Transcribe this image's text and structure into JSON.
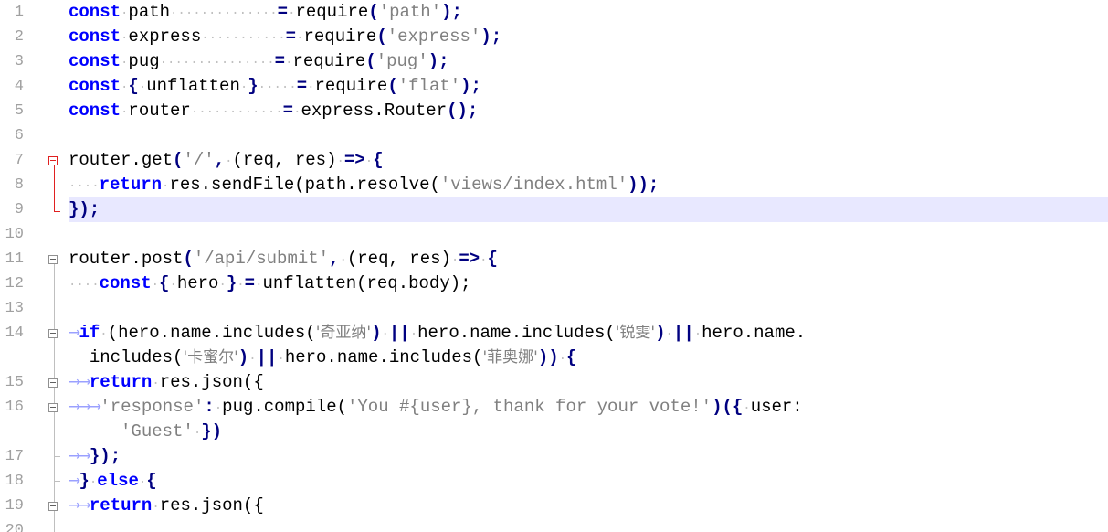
{
  "colors": {
    "keyword": "#0000ff",
    "string": "#808080",
    "operator": "#000080",
    "current_line_bg": "#e8e8ff",
    "fold_marker_active": "#e02020",
    "whitespace_marker": "#c0c0c0"
  },
  "gutter": {
    "line_numbers": [
      "1",
      "2",
      "3",
      "4",
      "5",
      "6",
      "7",
      "8",
      "9",
      "10",
      "11",
      "12",
      "13",
      "14",
      "15",
      "16",
      "17",
      "18",
      "19",
      "20"
    ]
  },
  "code": {
    "line1": {
      "kw": "const",
      "id": "path",
      "op": "=",
      "fn": "require",
      "str": "'path'"
    },
    "line2": {
      "kw": "const",
      "id": "express",
      "op": "=",
      "fn": "require",
      "str": "'express'"
    },
    "line3": {
      "kw": "const",
      "id": "pug",
      "op": "=",
      "fn": "require",
      "str": "'pug'"
    },
    "line4": {
      "kw": "const",
      "id": "unflatten",
      "op": "=",
      "fn": "require",
      "str": "'flat'"
    },
    "line5": {
      "kw": "const",
      "id": "router",
      "op": "=",
      "fn": "express.Router"
    },
    "line7": {
      "id": "router.get",
      "str": "'/'",
      "params": "(req, res)",
      "arrow": "=>"
    },
    "line8": {
      "kw": "return",
      "id": "res.sendFile(path.resolve(",
      "str": "'views/index.html'",
      "tail": "));"
    },
    "line9": {
      "text": "});"
    },
    "line11": {
      "id": "router.post",
      "str": "'/api/submit'",
      "params": "(req, res)",
      "arrow": "=>"
    },
    "line12": {
      "kw": "const",
      "id": "hero",
      "fn": "unflatten(req.body);"
    },
    "line14": {
      "kw": "if",
      "a": "(hero.name.includes(",
      "s1": "'奇亚纳'",
      "b": "hero.name.includes(",
      "s2": "'锐雯'",
      "c": "hero.name.",
      "d": "includes(",
      "s3": "'卡蜜尔'",
      "e": "hero.name.includes(",
      "s4": "'菲奥娜'",
      "f": "))",
      "or": "||"
    },
    "line15": {
      "kw": "return",
      "id": "res.json({"
    },
    "line16": {
      "key": "'response'",
      "id": "pug.compile(",
      "str": "'You #{user}, thank for your vote!'",
      "tail": ")({",
      "user": "user:",
      "guest": "'Guest'",
      "close": "})"
    },
    "line17": {
      "text": "});"
    },
    "line18": {
      "kw": "else"
    },
    "line19": {
      "kw": "return",
      "id": "res.json({"
    }
  }
}
